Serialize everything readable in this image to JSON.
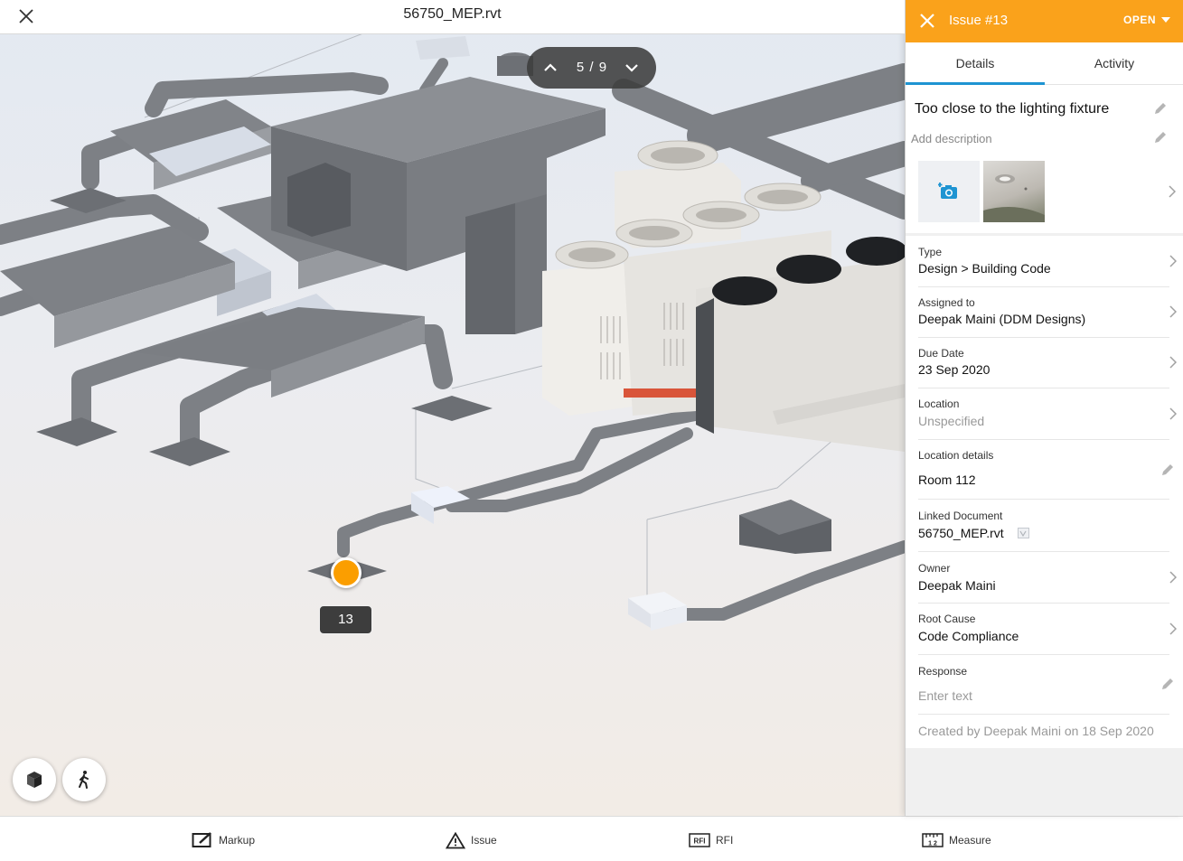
{
  "document": {
    "title": "56750_MEP.rvt"
  },
  "pager": {
    "current_of_total": "5 / 9"
  },
  "issue_pin": {
    "number": "13",
    "color": "#fb9e00"
  },
  "toolbar": [
    {
      "label": "Markup",
      "icon": "markup-icon"
    },
    {
      "label": "Issue",
      "icon": "issue-warning-icon"
    },
    {
      "label": "RFI",
      "icon": "rfi-icon"
    },
    {
      "label": "Measure",
      "icon": "measure-ruler-icon"
    }
  ],
  "view_buttons": [
    {
      "icon": "model-cube-icon"
    },
    {
      "icon": "walk-person-icon"
    }
  ],
  "panel": {
    "header_color": "#faa21b",
    "issue_title": "Issue #13",
    "status": "OPEN",
    "tabs": [
      {
        "label": "Details",
        "active": true
      },
      {
        "label": "Activity",
        "active": false
      }
    ],
    "issue_name": "Too close to the lighting fixture",
    "description_placeholder": "Add description",
    "fields": [
      {
        "label": "Type",
        "value": "Design > Building Code"
      },
      {
        "label": "Assigned to",
        "value": "Deepak Maini (DDM Designs)"
      },
      {
        "label": "Due Date",
        "value": "23 Sep 2020"
      },
      {
        "label": "Location",
        "value": "Unspecified"
      },
      {
        "label": "Location details",
        "value": "Room 112"
      },
      {
        "label": "Linked Document",
        "value": "56750_MEP.rvt"
      },
      {
        "label": "Owner",
        "value": "Deepak Maini"
      },
      {
        "label": "Root Cause",
        "value": "Code Compliance"
      },
      {
        "label": "Response",
        "value": "Enter text"
      }
    ],
    "created_note": "Created by Deepak Maini on 18 Sep 2020"
  }
}
